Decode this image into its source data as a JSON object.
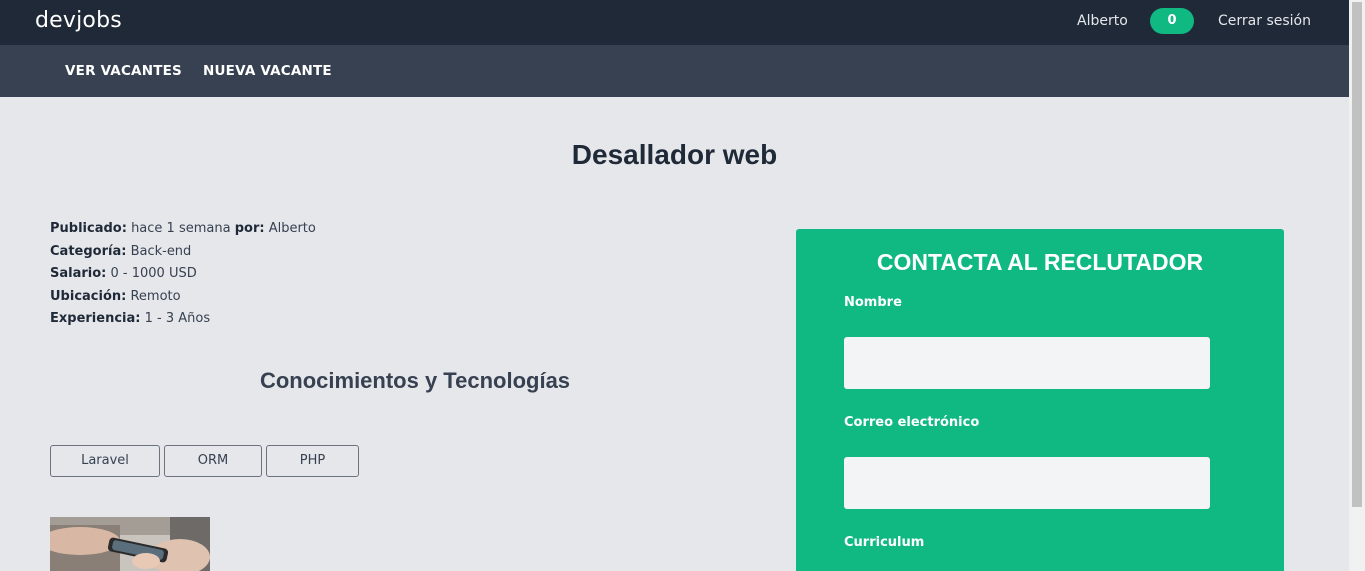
{
  "header": {
    "brand": "devjobs",
    "user_name": "Alberto",
    "notification_count": "0",
    "logout": "Cerrar sesión"
  },
  "nav": {
    "items": [
      {
        "label": "VER VACANTES"
      },
      {
        "label": "NUEVA VACANTE"
      }
    ]
  },
  "vacancy": {
    "title": "Desallador web",
    "published_label": "Publicado:",
    "published_value": "hace 1 semana",
    "by_label": "por:",
    "by_value": "Alberto",
    "category_label": "Categoría:",
    "category_value": "Back-end",
    "salary_label": "Salario:",
    "salary_value": "0 - 1000 USD",
    "location_label": "Ubicación:",
    "location_value": "Remoto",
    "experience_label": "Experiencia:",
    "experience_value": "1 - 3 Años",
    "skills_heading": "Conocimientos y Tecnologías",
    "skills": [
      "Laravel",
      "ORM",
      "PHP"
    ]
  },
  "contact": {
    "title": "CONTACTA AL RECLUTADOR",
    "name_label": "Nombre",
    "email_label": "Correo electrónico",
    "cv_label": "Curriculum"
  },
  "colors": {
    "topbar": "#1f2937",
    "navbar": "#374151",
    "accent": "#10b981",
    "background": "#e5e7eb"
  }
}
